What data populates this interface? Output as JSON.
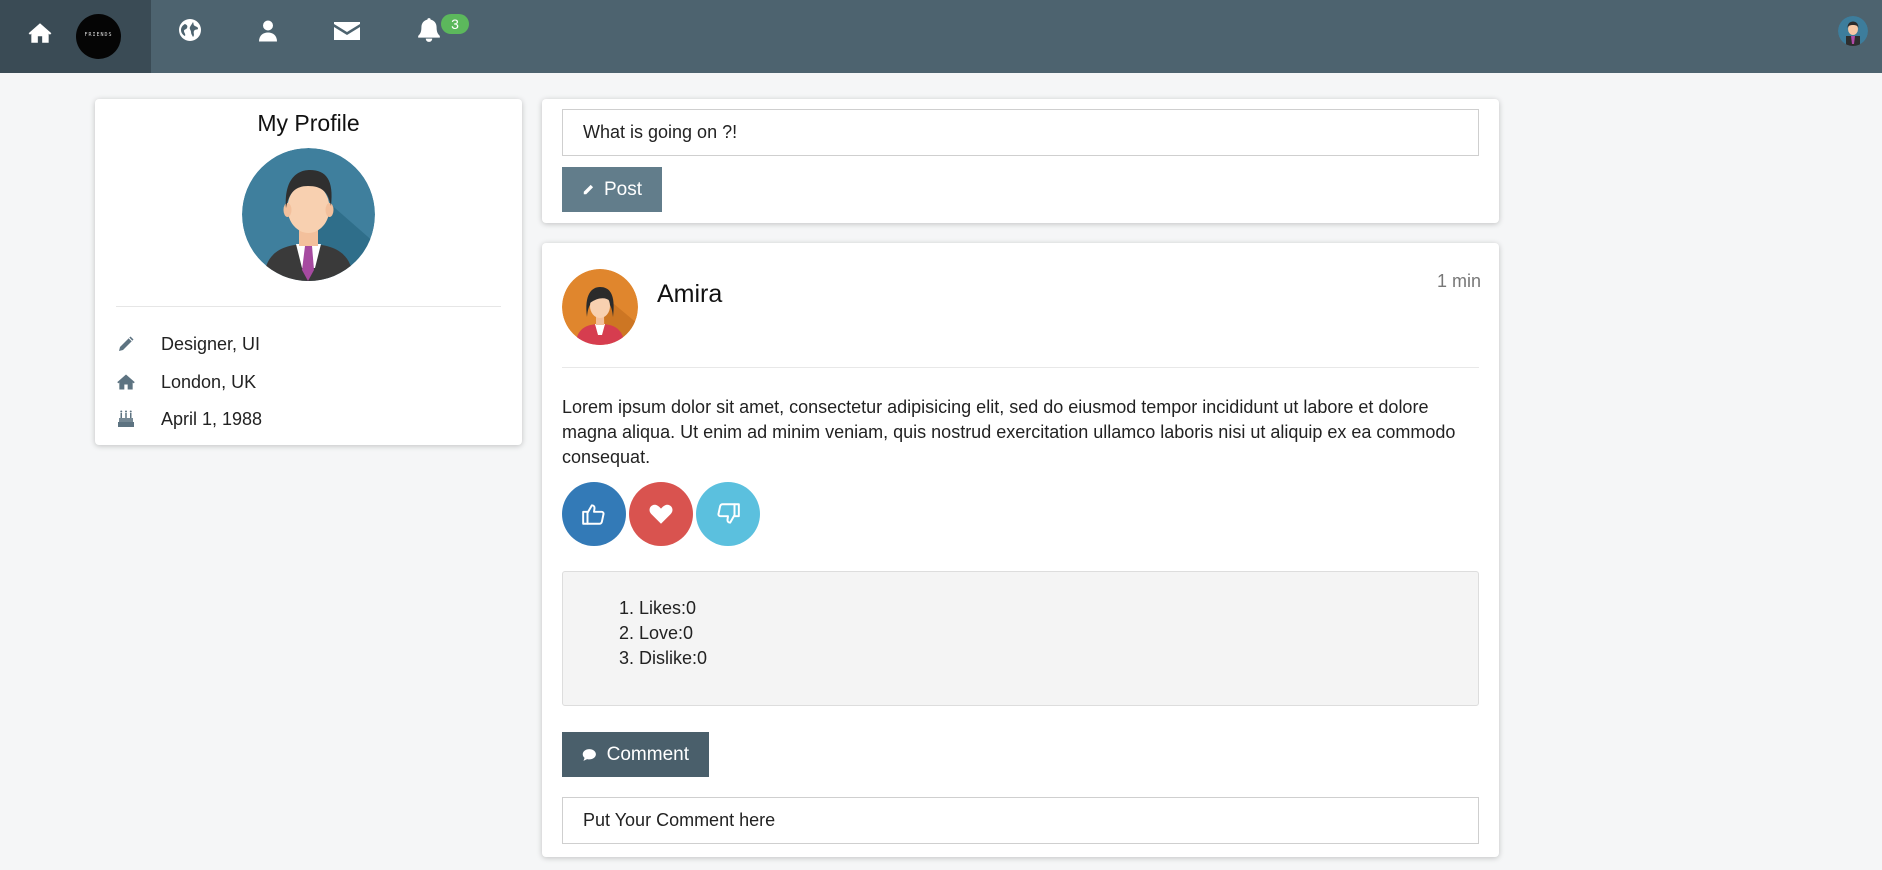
{
  "nav": {
    "logo_text": "FRIENDS",
    "notification_count": "3",
    "icons": [
      "home-icon",
      "globe-icon",
      "user-icon",
      "envelope-icon",
      "bell-icon"
    ]
  },
  "profile": {
    "title": "My Profile",
    "info": [
      {
        "icon": "pencil-icon",
        "text": "Designer, UI"
      },
      {
        "icon": "home-icon",
        "text": "London, UK"
      },
      {
        "icon": "birthday-cake-icon",
        "text": "April 1, 1988"
      }
    ]
  },
  "compose": {
    "value": "What is going on ?!",
    "post_label": "Post"
  },
  "post": {
    "author": "Amira",
    "time": "1 min",
    "body": "Lorem ipsum dolor sit amet, consectetur adipisicing elit, sed do eiusmod tempor incididunt ut labore et dolore magna aliqua. Ut enim ad minim veniam, quis nostrud exercitation ullamco laboris nisi ut aliquip ex ea commodo consequat.",
    "counts": [
      "1. Likes:0",
      "2. Love:0",
      "3. Dislike:0"
    ],
    "comment_label": "Comment",
    "comment_placeholder": "Put Your Comment here"
  },
  "colors": {
    "topbar": "#4d636f",
    "like": "#337ab7",
    "love": "#d9534f",
    "dislike": "#5bc0de",
    "badge": "#5cb85c"
  }
}
